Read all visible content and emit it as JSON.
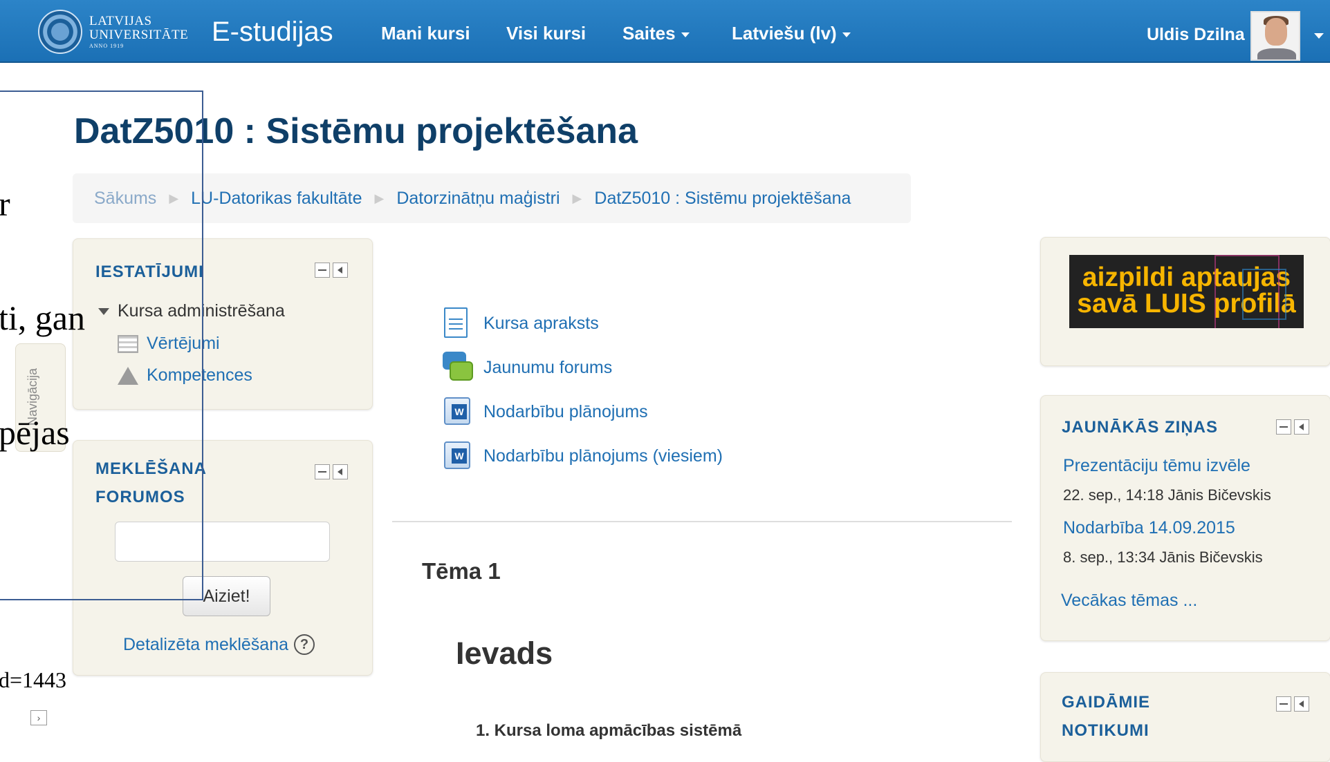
{
  "navbar": {
    "logo_line1": "LATVIJAS",
    "logo_line2": "UNIVERSITĀTE",
    "logo_line3": "ANNO 1919",
    "brand": "E-studijas",
    "items": [
      "Mani kursi",
      "Visi kursi",
      "Saites",
      "Latviešu (lv)"
    ],
    "user_name": "Uldis Dzilna"
  },
  "course": {
    "title": "DatZ5010 : Sistēmu projektēšana",
    "breadcrumb": [
      "Sākums",
      "LU-Datorikas fakultāte",
      "Datorzinātņu maģistri",
      "DatZ5010 : Sistēmu projektēšana"
    ]
  },
  "settings_block": {
    "title": "IESTATĪJUMI",
    "items": [
      "Kursa administrēšana",
      "Vērtējumi",
      "Kompetences"
    ]
  },
  "search_block": {
    "title_line1": "MEKLĒŠANA",
    "title_line2": "FORUMOS",
    "input_value": "",
    "button": "Aiziet!",
    "advanced": "Detalizēta meklēšana",
    "help": "?"
  },
  "side_tab": "Navigācija",
  "overlay_fragments": [
    "r",
    "ti, gan",
    "pējas",
    "d=1443"
  ],
  "small_icon": "›",
  "activities": [
    "Kursa apraksts",
    "Jaunumu forums",
    "Nodarbību plānojums",
    "Nodarbību plānojums (viesiem)"
  ],
  "topic": {
    "title": "Tēma 1",
    "section": "Ievads",
    "items": [
      "1. Kursa loma apmācības sistēmā"
    ]
  },
  "survey_banner": {
    "line1": "aizpildi aptaujas",
    "line2": "savā LUIS profilā"
  },
  "news_block": {
    "title": "JAUNĀKĀS ZIŅAS",
    "items": [
      {
        "title": "Prezentāciju tēmu izvēle",
        "meta": "22. sep., 14:18  Jānis Bičevskis"
      },
      {
        "title": "Nodarbība 14.09.2015",
        "meta": "8. sep., 13:34  Jānis Bičevskis"
      }
    ],
    "older": "Vecākas tēmas ..."
  },
  "events_block": {
    "title_line1": "GAIDĀMIE",
    "title_line2": "NOTIKUMI"
  }
}
